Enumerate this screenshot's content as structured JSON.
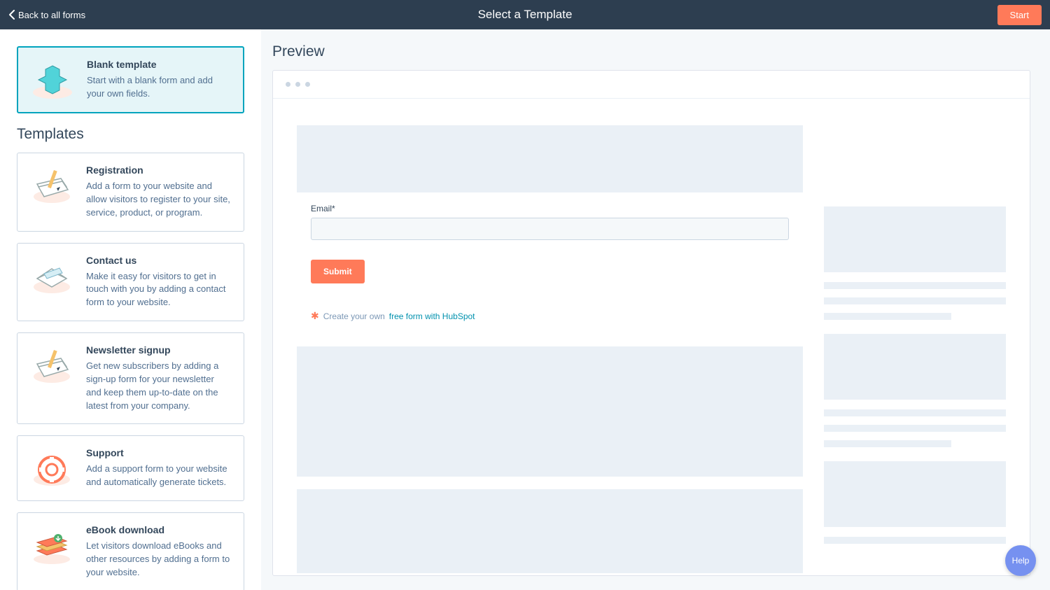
{
  "header": {
    "back_label": "Back to all forms",
    "title": "Select a Template",
    "start_label": "Start"
  },
  "blank_card": {
    "title": "Blank template",
    "desc": "Start with a blank form and add your own fields."
  },
  "templates_heading": "Templates",
  "templates": [
    {
      "title": "Registration",
      "desc": "Add a form to your website and allow visitors to register to your site, service, product, or program."
    },
    {
      "title": "Contact us",
      "desc": "Make it easy for visitors to get in touch with you by adding a contact form to your website."
    },
    {
      "title": "Newsletter signup",
      "desc": "Get new subscribers by adding a sign-up form for your newsletter and keep them up-to-date on the latest from your company."
    },
    {
      "title": "Support",
      "desc": "Add a support form to your website and automatically generate tickets."
    },
    {
      "title": "eBook download",
      "desc": "Let visitors download eBooks and other resources by adding a form to your website."
    }
  ],
  "preview": {
    "heading": "Preview",
    "email_label": "Email",
    "required_mark": "*",
    "submit_label": "Submit",
    "attr_prefix": "Create your own",
    "attr_link": "free form with HubSpot"
  },
  "help_label": "Help"
}
